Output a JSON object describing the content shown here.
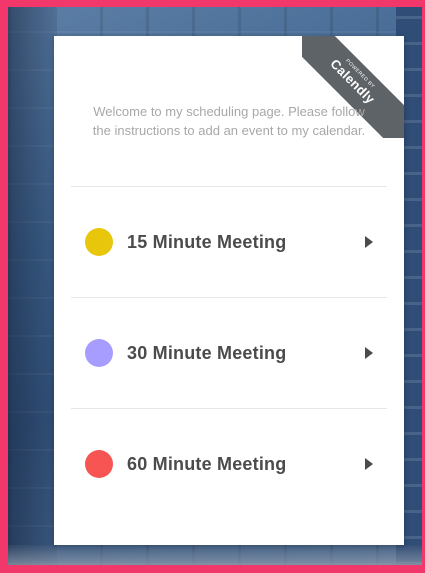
{
  "ribbon": {
    "powered_by": "POWERED BY",
    "brand": "Calendly"
  },
  "welcome_text": "Welcome to my scheduling page. Please follow the instructions to add an event to my calendar.",
  "events": [
    {
      "label": "15 Minute Meeting",
      "color": "#e8c60c",
      "icon": "chevron-right-icon"
    },
    {
      "label": "30 Minute Meeting",
      "color": "#a79cff",
      "icon": "chevron-right-icon"
    },
    {
      "label": "60 Minute Meeting",
      "color": "#f75454",
      "icon": "chevron-right-icon"
    }
  ],
  "colors": {
    "frame_border": "#f2386a",
    "ribbon": "#5e6367"
  }
}
